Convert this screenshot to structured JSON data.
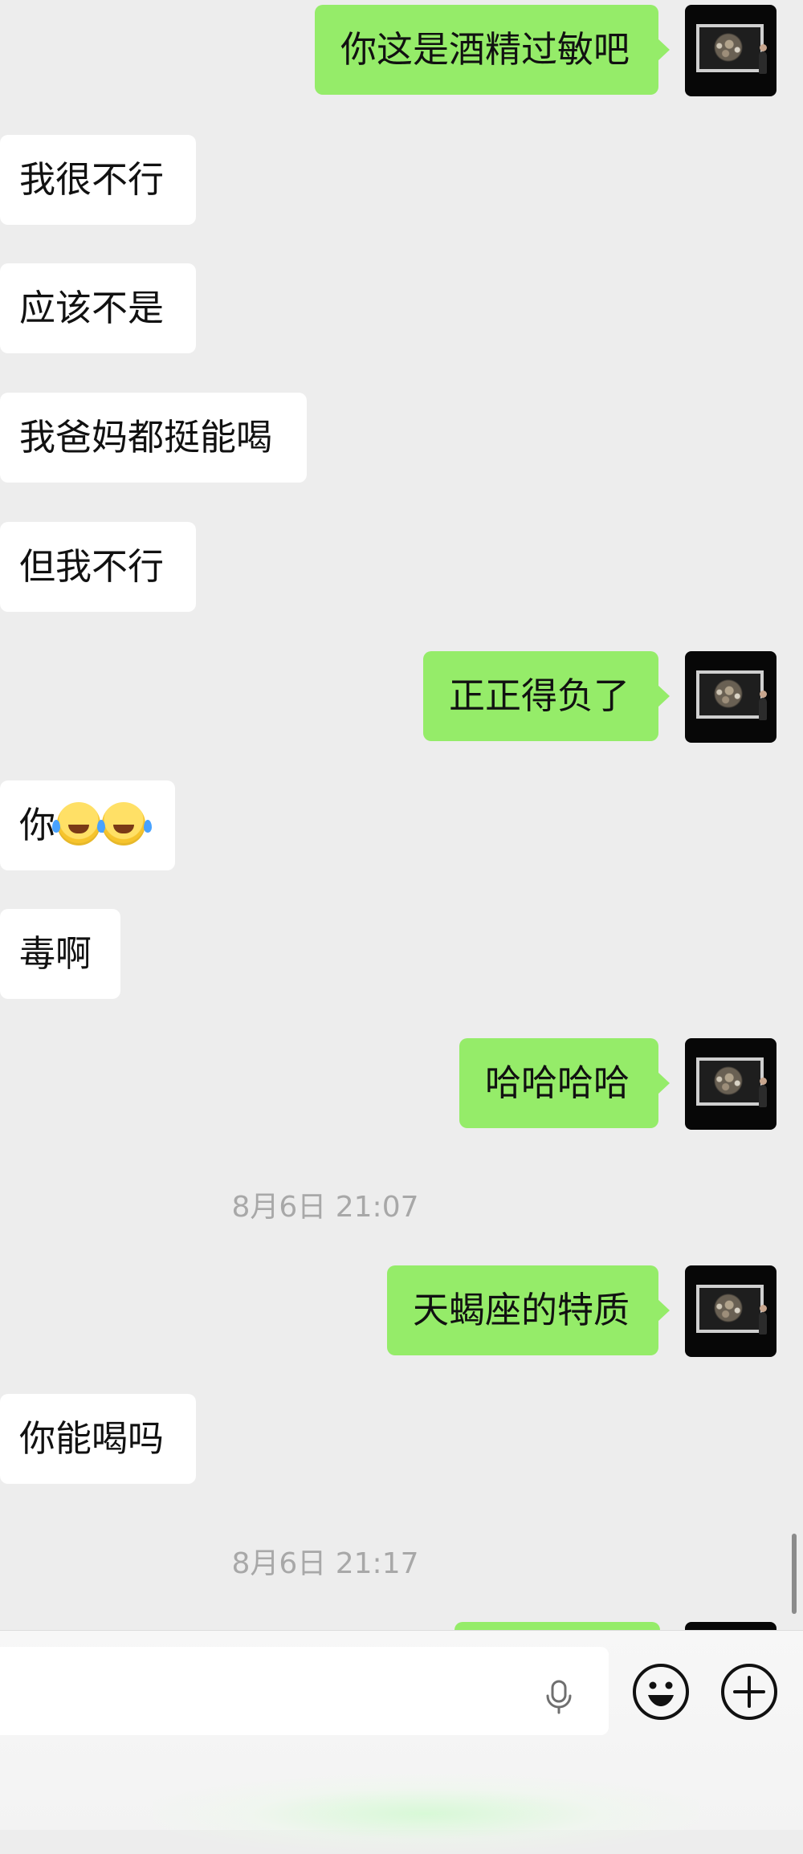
{
  "chat": {
    "messages": [
      {
        "side": "out",
        "text": "你这是酒精过敏吧"
      },
      {
        "side": "in",
        "text": "我很不行"
      },
      {
        "side": "in",
        "text": "应该不是"
      },
      {
        "side": "in",
        "text": "我爸妈都挺能喝"
      },
      {
        "side": "in",
        "text": "但我不行"
      },
      {
        "side": "out",
        "text": "正正得负了"
      },
      {
        "side": "in",
        "text": "你",
        "emoji": [
          "laughing-tears-emoji",
          "laughing-tears-emoji"
        ]
      },
      {
        "side": "in",
        "text": "毒啊"
      },
      {
        "side": "out",
        "text": "哈哈哈哈"
      },
      {
        "side": "out",
        "text": "天蝎座的特质"
      },
      {
        "side": "in",
        "text": "你能喝吗"
      }
    ],
    "timestamps": [
      "8月6日 21:07",
      "8月6日 21:17"
    ]
  },
  "input_bar": {
    "text_value": "",
    "mic_icon": "microphone-icon",
    "emoji_icon": "smiley-icon",
    "more_icon": "plus-icon"
  },
  "colors": {
    "background": "#ededed",
    "outgoing_bubble": "#95ec69",
    "incoming_bubble": "#ffffff",
    "timestamp": "#a8a8a8"
  }
}
